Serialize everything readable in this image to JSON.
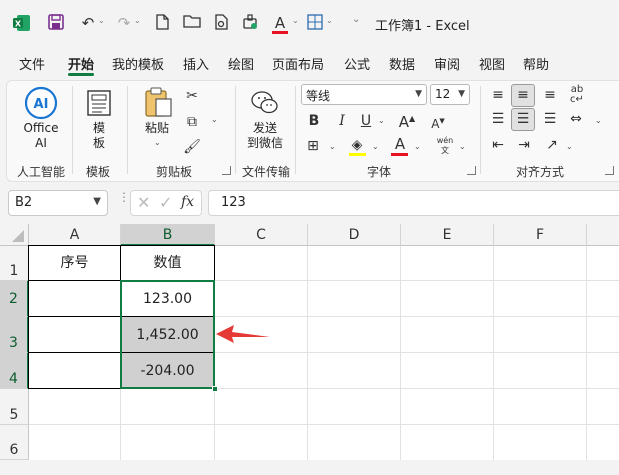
{
  "app": {
    "title": "工作簿1 - Excel"
  },
  "menu_tabs": [
    {
      "label": "文件"
    },
    {
      "label": "开始"
    },
    {
      "label": "我的模板"
    },
    {
      "label": "插入"
    },
    {
      "label": "绘图"
    },
    {
      "label": "页面布局"
    },
    {
      "label": "公式"
    },
    {
      "label": "数据"
    },
    {
      "label": "审阅"
    },
    {
      "label": "视图"
    },
    {
      "label": "帮助"
    }
  ],
  "ribbon": {
    "office_ai": {
      "label_line1": "Office",
      "label_line2": "AI",
      "badge": "AI"
    },
    "template": {
      "label_line1": "模",
      "label_line2": "板"
    },
    "paste": {
      "label": "粘贴"
    },
    "send": {
      "label_line1": "发送",
      "label_line2": "到微信"
    },
    "font_name": "等线",
    "font_size": "12",
    "bold": "B",
    "italic": "I",
    "underline": "U",
    "font_color_glyph": "A",
    "phonetic": "wén",
    "groups": {
      "ai": "人工智能",
      "template": "模板",
      "clipboard": "剪贴板",
      "file_transfer": "文件传输",
      "font": "字体",
      "alignment": "对齐方式"
    }
  },
  "formula_bar": {
    "name_box": "B2",
    "fx": "fx",
    "value": "123"
  },
  "sheet": {
    "columns": [
      "A",
      "B",
      "C",
      "D",
      "E",
      "F"
    ],
    "rows": [
      "1",
      "2",
      "3",
      "4",
      "5",
      "6"
    ],
    "cells": {
      "A1": "序号",
      "B1": "数值",
      "B2": "123.00",
      "B3": "1,452.00",
      "B4": "-204.00"
    }
  },
  "colors": {
    "accent": "#107c41",
    "selection_fill": "#d0d0d0",
    "arrow": "#e53935",
    "font_color_bar": "#e81123",
    "highlight_bar": "#ffff00"
  }
}
